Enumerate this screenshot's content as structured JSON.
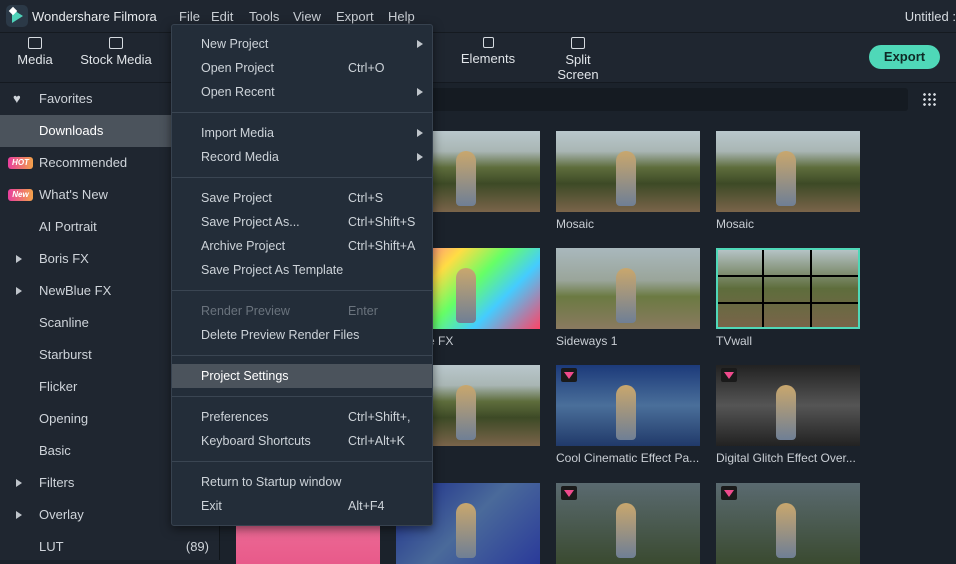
{
  "app": {
    "name": "Wondershare Filmora",
    "project_title": "Untitled :"
  },
  "menubar": [
    "File",
    "Edit",
    "Tools",
    "View",
    "Export",
    "Help"
  ],
  "toolbar": {
    "tabs": [
      {
        "label": "Media",
        "icon": "folder-icon"
      },
      {
        "label": "Stock Media",
        "icon": "cloud-folder-icon"
      },
      {
        "label": "Elements",
        "icon": "elements-icon"
      },
      {
        "label": "Split Screen",
        "icon": "split-screen-icon"
      }
    ],
    "export_label": "Export",
    "accent": "#4fd8b8"
  },
  "sidebar": {
    "items": [
      {
        "label": "Favorites",
        "icon": "heart-icon"
      },
      {
        "label": "Downloads",
        "active": true
      },
      {
        "label": "Recommended",
        "badge": "HOT"
      },
      {
        "label": "What's New",
        "badge": "New"
      },
      {
        "label": "AI Portrait"
      },
      {
        "label": "Boris FX",
        "expandable": true
      },
      {
        "label": "NewBlue FX",
        "expandable": true
      },
      {
        "label": "Scanline"
      },
      {
        "label": "Starburst"
      },
      {
        "label": "Flicker"
      },
      {
        "label": "Opening"
      },
      {
        "label": "Basic"
      },
      {
        "label": "Filters",
        "expandable": true
      },
      {
        "label": "Overlay",
        "expandable": true
      },
      {
        "label": "LUT",
        "count": "(89)"
      }
    ]
  },
  "grid": {
    "items": [
      {
        "label": ""
      },
      {
        "label": "Mosaic"
      },
      {
        "label": "Mosaic"
      },
      {
        "label": "Explike FX"
      },
      {
        "label": "Sideways 1"
      },
      {
        "label": "TVwall",
        "selected": true
      },
      {
        "label": "ia"
      },
      {
        "label": "Cool Cinematic Effect Pa...",
        "premium": true
      },
      {
        "label": "Digital Glitch Effect Over...",
        "premium": true
      },
      {
        "label": ""
      },
      {
        "label": "",
        "premium": true
      },
      {
        "label": "",
        "premium": true
      }
    ]
  },
  "file_menu": {
    "groups": [
      [
        {
          "label": "New Project",
          "submenu": true
        },
        {
          "label": "Open Project",
          "shortcut": "Ctrl+O"
        },
        {
          "label": "Open Recent",
          "submenu": true
        }
      ],
      [
        {
          "label": "Import Media",
          "submenu": true
        },
        {
          "label": "Record Media",
          "submenu": true
        }
      ],
      [
        {
          "label": "Save Project",
          "shortcut": "Ctrl+S"
        },
        {
          "label": "Save Project As...",
          "shortcut": "Ctrl+Shift+S"
        },
        {
          "label": "Archive Project",
          "shortcut": "Ctrl+Shift+A"
        },
        {
          "label": "Save Project As Template"
        }
      ],
      [
        {
          "label": "Render Preview",
          "shortcut": "Enter",
          "disabled": true
        },
        {
          "label": "Delete Preview Render Files"
        }
      ],
      [
        {
          "label": "Project Settings",
          "highlighted": true
        }
      ],
      [
        {
          "label": "Preferences",
          "shortcut": "Ctrl+Shift+,"
        },
        {
          "label": "Keyboard Shortcuts",
          "shortcut": "Ctrl+Alt+K"
        }
      ],
      [
        {
          "label": "Return to Startup window"
        },
        {
          "label": "Exit",
          "shortcut": "Alt+F4"
        }
      ]
    ]
  }
}
